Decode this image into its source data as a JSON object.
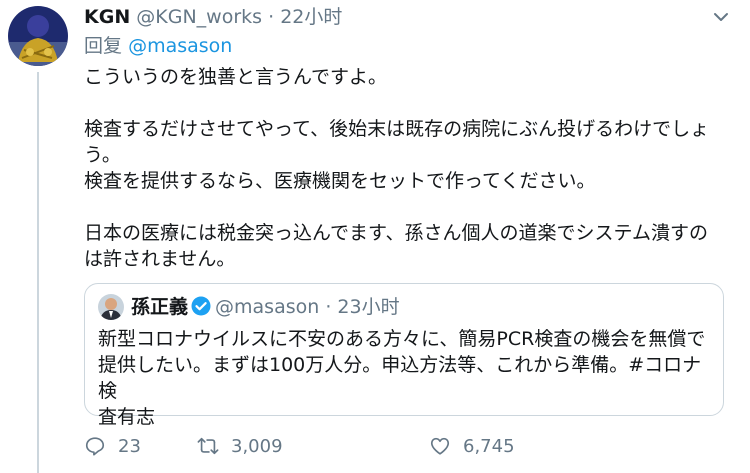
{
  "tweet": {
    "author_name": "KGN",
    "author_handle": "@KGN_works",
    "separator": "·",
    "time": "22小时",
    "reply_prefix": "回复",
    "reply_mention": "@masason",
    "body_lines": [
      "こういうのを独善と言うんですよ。",
      "検査するだけさせてやって、後始末は既存の病院にぶん投げるわけでしょ",
      "う。",
      "検査を提供するなら、医療機関をセットで作ってください。",
      "日本の医療には税金突っ込んでます、孫さん個人の道楽でシステム潰すの",
      "は許されません。"
    ],
    "icons": {
      "menu": "chevron-down-icon",
      "verified": "verified-badge-icon"
    }
  },
  "quoted": {
    "author_name": "孫正義",
    "author_handle": "@masason",
    "separator": "·",
    "time": "23小时",
    "text_lines": [
      "新型コロナウイルスに不安のある方々に、簡易PCR検査の機会を無償で",
      "提供したい。まずは100万人分。申込方法等、これから準備。#コロナ検",
      "査有志"
    ]
  },
  "actions": {
    "replies": "23",
    "retweets": "3,009",
    "likes": "6,745"
  },
  "colors": {
    "text": "#14171a",
    "muted": "#657786",
    "link": "#1b95e0",
    "border": "#ccd6dd"
  }
}
